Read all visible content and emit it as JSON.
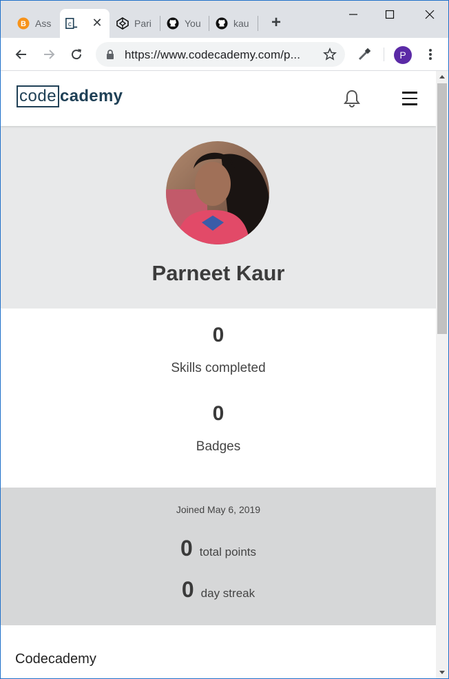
{
  "browser": {
    "tabs": [
      {
        "title": "Ass",
        "icon": "bitcoin-icon"
      },
      {
        "title": "",
        "icon": "codecademy-icon"
      },
      {
        "title": "Pari",
        "icon": "codepen-icon"
      },
      {
        "title": "You",
        "icon": "github-icon"
      },
      {
        "title": "kau",
        "icon": "github-icon"
      }
    ],
    "url": "https://www.codecademy.com/p...",
    "profile_initial": "P"
  },
  "site": {
    "logo_box": "code",
    "logo_rest": "cademy"
  },
  "profile": {
    "name": "Parneet Kaur",
    "skills_count": "0",
    "skills_label": "Skills completed",
    "badges_count": "0",
    "badges_label": "Badges",
    "joined": "Joined May 6, 2019",
    "points": "0",
    "points_label": "total points",
    "streak": "0",
    "streak_label": "day streak"
  },
  "footer": {
    "title": "Codecademy"
  },
  "colors": {
    "brand": "#1f4056",
    "hero_bg": "#e8e9ea",
    "info_bg": "#d6d7d8",
    "avatar": "#5b2aa6"
  }
}
